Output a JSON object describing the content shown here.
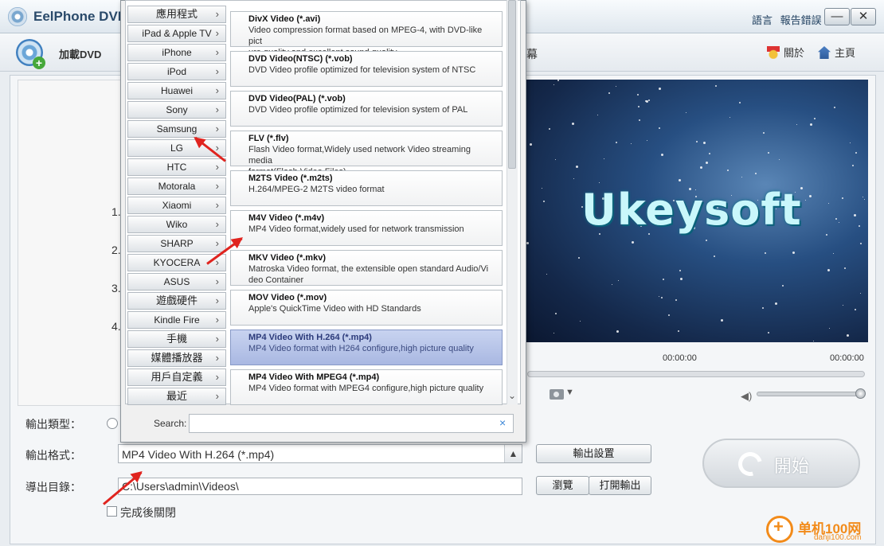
{
  "window": {
    "title": "EelPhone DVD",
    "links": [
      "語言",
      "報告錯誤"
    ],
    "minimize": "—",
    "close": "✕"
  },
  "toolbar": {
    "load_dvd": "加載DVD",
    "subtitle": "幕",
    "about": "關於",
    "home": "主頁"
  },
  "steps": [
    "1.",
    "2.",
    "3.",
    "4."
  ],
  "preview": {
    "brand_text": "Ukeysoft",
    "time_current": "00:00:00",
    "time_total": "00:00:00",
    "volume_level": 1.0,
    "icons": {
      "camera": "camera-icon",
      "volume": "volume-icon"
    }
  },
  "form": {
    "output_type_label": "輸出類型：",
    "output_format_label": "輸出格式：",
    "output_format_value": "MP4 Video With H.264 (*.mp4)",
    "output_dir_label": "導出目錄：",
    "output_dir_value": "C:\\Users\\admin\\Videos\\",
    "output_settings_btn": "輸出設置",
    "browse_btn": "瀏覽",
    "open_output_btn": "打開輸出",
    "close_after_label": "完成後關閉",
    "start_btn": "開始"
  },
  "dropdown": {
    "categories": [
      {
        "label": "應用程式"
      },
      {
        "label": "iPad & Apple TV"
      },
      {
        "label": "iPhone"
      },
      {
        "label": "iPod"
      },
      {
        "label": "Huawei"
      },
      {
        "label": "Sony"
      },
      {
        "label": "Samsung"
      },
      {
        "label": "LG"
      },
      {
        "label": "HTC"
      },
      {
        "label": "Motorala"
      },
      {
        "label": "Xiaomi"
      },
      {
        "label": "Wiko"
      },
      {
        "label": "SHARP"
      },
      {
        "label": "KYOCERA"
      },
      {
        "label": "ASUS"
      },
      {
        "label": "遊戲硬件"
      },
      {
        "label": "Kindle Fire"
      },
      {
        "label": "手機"
      },
      {
        "label": "媒體播放器"
      },
      {
        "label": "用戶自定義"
      },
      {
        "label": "最近"
      }
    ],
    "formats": [
      {
        "title": "DivX Video (*.avi)",
        "desc": "Video compression format based on MPEG-4, with DVD-like pict",
        "desc2": "ure quality and excellent sound quality."
      },
      {
        "title": "DVD Video(NTSC) (*.vob)",
        "desc": "DVD Video profile optimized for television system of NTSC",
        "desc2": ""
      },
      {
        "title": "DVD Video(PAL) (*.vob)",
        "desc": "DVD Video profile optimized for television system of PAL",
        "desc2": ""
      },
      {
        "title": "FLV (*.flv)",
        "desc": "Flash Video format,Widely used network Video streaming media",
        "desc2": " format(Flash Video Files)"
      },
      {
        "title": "M2TS Video (*.m2ts)",
        "desc": "H.264/MPEG-2 M2TS video format",
        "desc2": ""
      },
      {
        "title": "M4V Video (*.m4v)",
        "desc": "MP4 Video format,widely used for network transmission",
        "desc2": ""
      },
      {
        "title": "MKV Video (*.mkv)",
        "desc": "Matroska Video format, the extensible open standard Audio/Vi",
        "desc2": "deo Container"
      },
      {
        "title": "MOV Video (*.mov)",
        "desc": "Apple's QuickTime Video with HD Standards",
        "desc2": ""
      },
      {
        "title": "MP4 Video With H.264 (*.mp4)",
        "desc": "MP4 Video format with H264 configure,high picture quality",
        "desc2": ""
      },
      {
        "title": "MP4 Video With MPEG4 (*.mp4)",
        "desc": "MP4 Video format with MPEG4 configure,high picture quality",
        "desc2": ""
      }
    ],
    "search_label": "Search:",
    "search_value": "",
    "clear_icon": "×"
  },
  "watermark": {
    "site": "单机100网",
    "url": "danji100.com"
  },
  "colors": {
    "selected_format": "#a9b8e2",
    "annotation_arrow": "#e0241f",
    "watermark": "#f28b1a"
  }
}
